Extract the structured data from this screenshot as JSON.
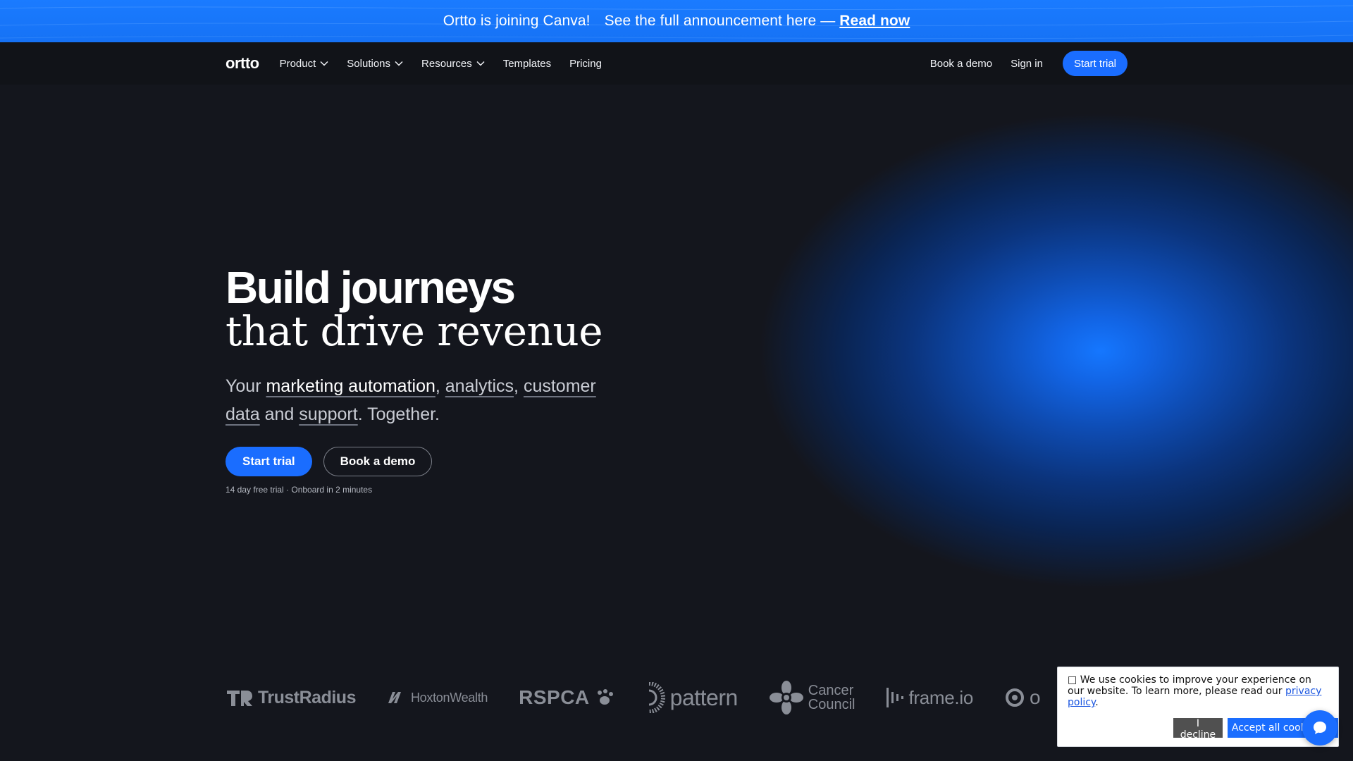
{
  "announcement": {
    "text1": "Ortto is joining Canva!",
    "text2": "See the full announcement here —",
    "link": "Read now"
  },
  "nav": {
    "logo": "ortto",
    "items": [
      {
        "label": "Product",
        "dropdown": true
      },
      {
        "label": "Solutions",
        "dropdown": true
      },
      {
        "label": "Resources",
        "dropdown": true
      },
      {
        "label": "Templates",
        "dropdown": false
      },
      {
        "label": "Pricing",
        "dropdown": false
      }
    ],
    "book_demo": "Book a demo",
    "sign_in": "Sign in",
    "start_trial": "Start trial"
  },
  "hero": {
    "title_line1": "Build journeys",
    "title_line2": "that drive revenue",
    "sub": {
      "w1": "Your",
      "l1": "marketing automation",
      "c1": ",",
      "l2": "analytics",
      "c2": ",",
      "l3": "customer data",
      "and": "and",
      "l4": "support",
      "end": ". Together."
    },
    "cta_primary": "Start trial",
    "cta_secondary": "Book a demo",
    "note": "14 day free trial · Onboard in 2 minutes"
  },
  "logos": {
    "trust": "TrustRadius",
    "hoxton": "HoxtonWealth",
    "rspca": "RSPCA",
    "pattern": "pattern",
    "cancer1": "Cancer",
    "cancer2": "Council",
    "frame": "frame.io",
    "o": "o"
  },
  "cookie": {
    "icon": "cookie-icon",
    "text": "We use cookies to improve your experience on our website. To learn more, please read our",
    "link": "privacy policy",
    "end": ".",
    "decline": "I decline",
    "accept": "Accept all cookies"
  },
  "colors": {
    "announcement_bg": "#1a7bff",
    "accent": "#1a6dff",
    "page_bg": "#14161d",
    "glow": "#1577ff"
  }
}
